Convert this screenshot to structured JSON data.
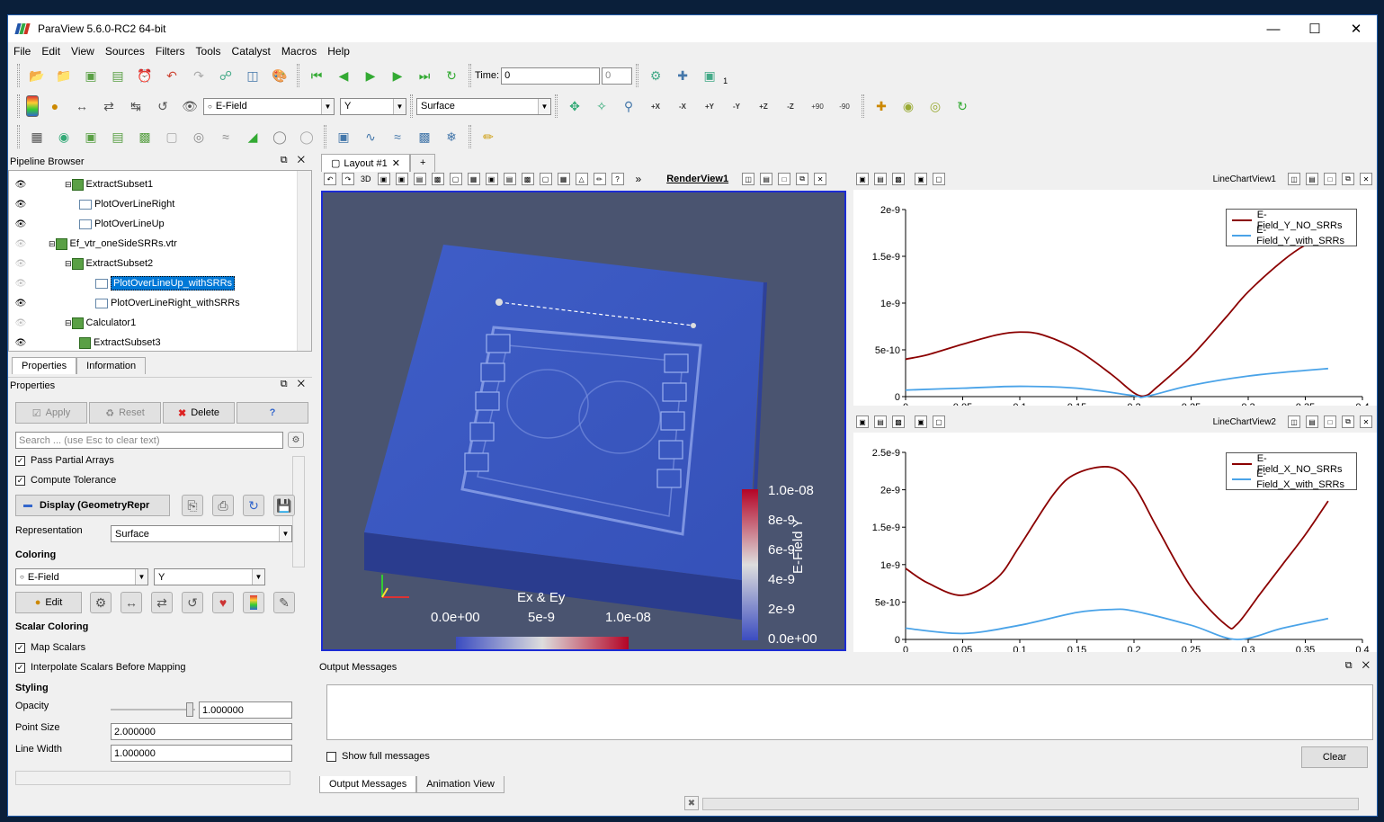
{
  "window": {
    "title": "ParaView 5.6.0-RC2 64-bit"
  },
  "menu": [
    "File",
    "Edit",
    "View",
    "Sources",
    "Filters",
    "Tools",
    "Catalyst",
    "Macros",
    "Help"
  ],
  "toolbar": {
    "time_label": "Time:",
    "time_value": "0",
    "timestep_value": "0",
    "timestep_suffix": "1",
    "color_array": "E-Field",
    "color_component": "Y",
    "representation": "Surface"
  },
  "camera_buttons": [
    "+X",
    "-X",
    "+Y",
    "-Y",
    "+Z",
    "-Z",
    "+90",
    "-90"
  ],
  "pipeline": {
    "title": "Pipeline Browser",
    "items": [
      {
        "label": "ExtractSubset1",
        "visible": true
      },
      {
        "label": "PlotOverLineRight",
        "visible": true
      },
      {
        "label": "PlotOverLineUp",
        "visible": true
      },
      {
        "label": "Ef_vtr_oneSideSRRs.vtr",
        "visible": false
      },
      {
        "label": "ExtractSubset2",
        "visible": false
      },
      {
        "label": "PlotOverLineUp_withSRRs",
        "visible": false
      },
      {
        "label": "PlotOverLineRight_withSRRs",
        "visible": true
      },
      {
        "label": "Calculator1",
        "visible": false
      },
      {
        "label": "ExtractSubset3",
        "visible": true
      }
    ]
  },
  "panel_tabs": {
    "properties": "Properties",
    "information": "Information"
  },
  "properties": {
    "title": "Properties",
    "apply": "Apply",
    "reset": "Reset",
    "delete": "Delete",
    "help": "?",
    "search_placeholder": "Search ... (use Esc to clear text)",
    "pass_partial": "Pass Partial Arrays",
    "compute_tol": "Compute Tolerance",
    "display_label": "Display (GeometryRepr",
    "representation_label": "Representation",
    "representation_value": "Surface",
    "coloring_section": "Coloring",
    "coloring_array": "E-Field",
    "coloring_comp": "Y",
    "edit": "Edit",
    "scalar_section": "Scalar Coloring",
    "map_scalars": "Map Scalars",
    "interp": "Interpolate Scalars Before Mapping",
    "styling_section": "Styling",
    "opacity_label": "Opacity",
    "opacity_value": "1.000000",
    "pointsize_label": "Point Size",
    "pointsize_value": "2.000000",
    "linewidth_label": "Line Width",
    "linewidth_value": "1.000000"
  },
  "layout": {
    "tab": "Layout #1",
    "add": "+",
    "render_view": "RenderView1",
    "chart1": "LineChartView1",
    "chart2": "LineChartView2",
    "btn_3d": "3D"
  },
  "render": {
    "bar_h": {
      "title": "Ex & Ey",
      "labels": [
        "0.0e+00",
        "5e-9",
        "1.0e-08"
      ]
    },
    "bar_v": {
      "title": "E-Field Y",
      "labels": [
        "1.0e-08",
        "8e-9",
        "6e-9",
        "4e-9",
        "2e-9",
        "0.0e+00"
      ]
    }
  },
  "chart1_data": {
    "type": "line",
    "xlim": [
      0,
      0.4
    ],
    "ylim": [
      0,
      2e-09
    ],
    "xticks": [
      "0",
      "0.05",
      "0.1",
      "0.15",
      "0.2",
      "0.25",
      "0.3",
      "0.35",
      "0.4"
    ],
    "yticks": [
      "0",
      "5e-10",
      "1e-9",
      "1.5e-9",
      "2e-9"
    ],
    "series": [
      {
        "name": "E-Field_Y_NO_SRRs",
        "color": "#8b0000",
        "x": [
          0,
          0.02,
          0.05,
          0.08,
          0.1,
          0.12,
          0.15,
          0.18,
          0.2,
          0.21,
          0.22,
          0.25,
          0.28,
          0.3,
          0.33,
          0.35,
          0.37
        ],
        "y": [
          4e-10,
          4.5e-10,
          5.6e-10,
          6.6e-10,
          6.9e-10,
          6.6e-10,
          5e-10,
          2.4e-10,
          4e-11,
          1e-11,
          1e-10,
          4.3e-10,
          8.4e-10,
          1.12e-09,
          1.45e-09,
          1.62e-09,
          1.72e-09
        ]
      },
      {
        "name": "E-Field_Y_with_SRRs",
        "color": "#4aa3e8",
        "x": [
          0,
          0.05,
          0.1,
          0.15,
          0.2,
          0.21,
          0.25,
          0.3,
          0.35,
          0.37
        ],
        "y": [
          7e-11,
          9e-11,
          1.1e-10,
          9e-11,
          1e-11,
          0,
          1.2e-10,
          2.2e-10,
          2.8e-10,
          3e-10
        ]
      }
    ]
  },
  "chart2_data": {
    "type": "line",
    "xlim": [
      0,
      0.4
    ],
    "ylim": [
      0,
      2.5e-09
    ],
    "xticks": [
      "0",
      "0.05",
      "0.1",
      "0.15",
      "0.2",
      "0.25",
      "0.3",
      "0.35",
      "0.4"
    ],
    "yticks": [
      "0",
      "5e-10",
      "1e-9",
      "1.5e-9",
      "2e-9",
      "2.5e-9"
    ],
    "series": [
      {
        "name": "E-Field_X_NO_SRRs",
        "color": "#8b0000",
        "x": [
          0,
          0.02,
          0.05,
          0.08,
          0.1,
          0.13,
          0.15,
          0.18,
          0.2,
          0.22,
          0.25,
          0.28,
          0.29,
          0.31,
          0.33,
          0.35,
          0.37
        ],
        "y": [
          9.5e-10,
          7.5e-10,
          5.9e-10,
          8.2e-10,
          1.25e-09,
          1.95e-09,
          2.22e-09,
          2.3e-09,
          2.05e-09,
          1.5e-09,
          7e-10,
          2e-10,
          2e-10,
          6e-10,
          1e-09,
          1.4e-09,
          1.85e-09
        ]
      },
      {
        "name": "E-Field_X_with_SRRs",
        "color": "#4aa3e8",
        "x": [
          0,
          0.05,
          0.1,
          0.15,
          0.18,
          0.2,
          0.25,
          0.29,
          0.33,
          0.37
        ],
        "y": [
          1.5e-10,
          8e-11,
          1.9e-10,
          3.6e-10,
          4e-10,
          3.8e-10,
          1.9e-10,
          0,
          1.5e-10,
          2.8e-10
        ]
      }
    ]
  },
  "output": {
    "title": "Output Messages",
    "show_full": "Show full messages",
    "clear": "Clear",
    "tab1": "Output Messages",
    "tab2": "Animation View"
  }
}
